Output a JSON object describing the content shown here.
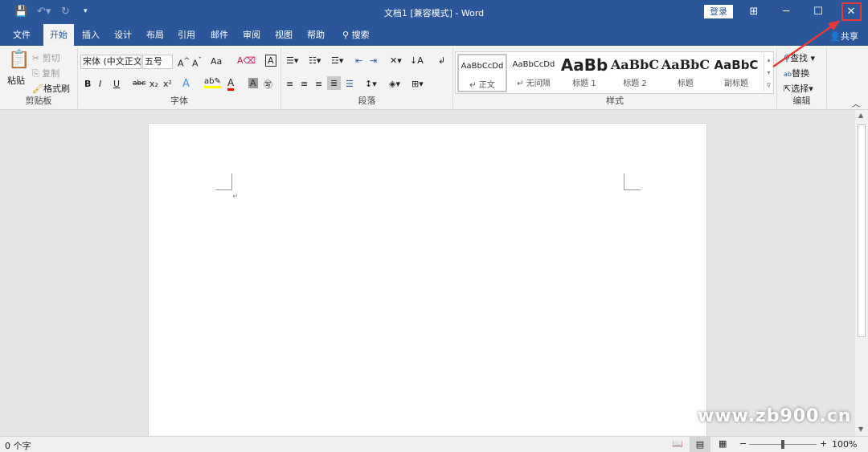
{
  "titlebar": {
    "title": "文档1 [兼容模式]  -  Word",
    "login": "登录",
    "icons": [
      "save-icon",
      "undo-icon",
      "redo-icon",
      "customize-icon",
      "ribbon-display-icon",
      "minimize-icon",
      "maximize-icon",
      "close-icon"
    ]
  },
  "tabs": [
    "文件",
    "开始",
    "插入",
    "设计",
    "布局",
    "引用",
    "邮件",
    "审阅",
    "视图",
    "帮助"
  ],
  "search": "搜索",
  "share": "共享",
  "active_tab": "开始",
  "clipboard": {
    "paste": "粘贴",
    "cut": "剪切",
    "copy": "复制",
    "format_painter": "格式刷",
    "label": "剪贴板"
  },
  "font": {
    "name": "宋体 (中文正文)",
    "size": "五号",
    "case": "Aa",
    "label": "字体",
    "bold": "B",
    "italic": "I",
    "underline": "U",
    "strike": "abc",
    "sub": "x₂",
    "sup": "x²"
  },
  "paragraph": {
    "label": "段落"
  },
  "styles": {
    "label": "样式",
    "items": [
      {
        "sample": "AaBbCcDd",
        "name": "↵ 正文"
      },
      {
        "sample": "AaBbCcDd",
        "name": "↵ 无间隔"
      },
      {
        "sample": "AaBb",
        "name": "标题 1"
      },
      {
        "sample": "AaBbC",
        "name": "标题 2"
      },
      {
        "sample": "AaBbC",
        "name": "标题"
      },
      {
        "sample": "AaBbC",
        "name": "副标题"
      }
    ]
  },
  "editing": {
    "find": "查找",
    "replace": "替换",
    "select": "选择",
    "label": "编辑"
  },
  "status": {
    "words": "0 个字",
    "zoom": "100%",
    "zoom_level_percent": 100
  },
  "watermark": "www.zb900.cn",
  "colors": {
    "accent": "#2b579a",
    "highlight": "#ffff00",
    "font_color": "#ff0000",
    "annotation": "#e53935"
  }
}
